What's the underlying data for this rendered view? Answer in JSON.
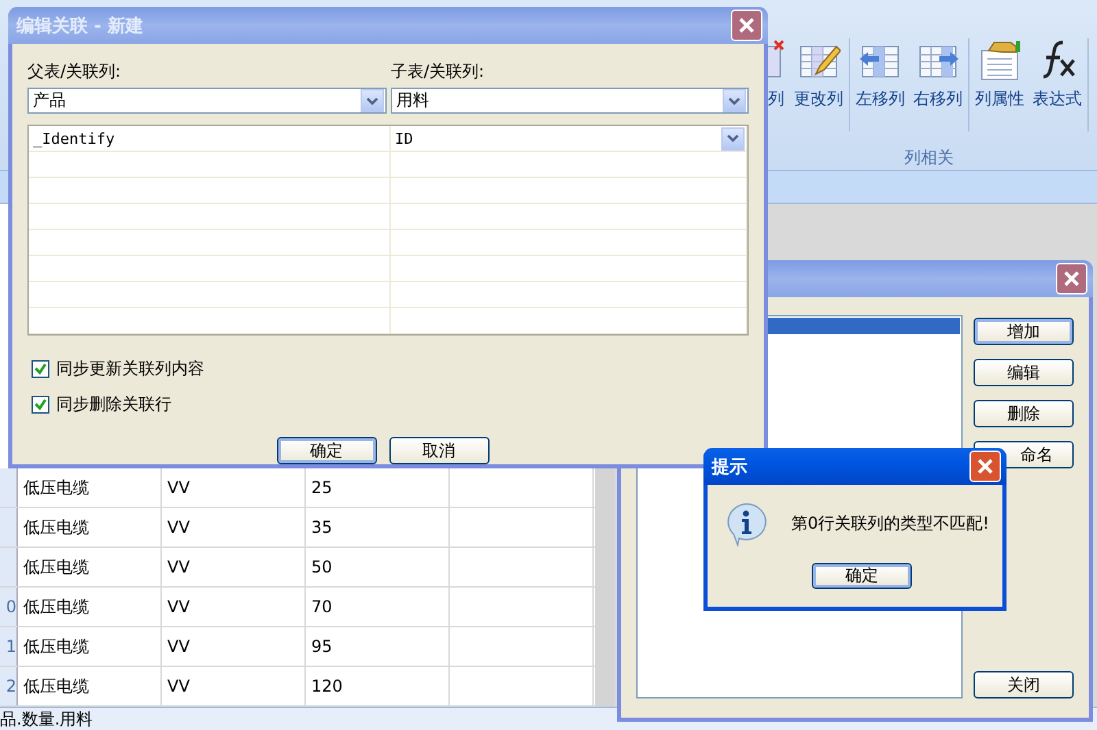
{
  "ribbon": {
    "button_groups": [
      [
        {
          "label": "列",
          "kind": "delete-column"
        },
        {
          "label": "更改列",
          "kind": "edit-column"
        }
      ],
      [
        {
          "label": "左移列",
          "kind": "move-left"
        },
        {
          "label": "右移列",
          "kind": "move-right"
        }
      ],
      [
        {
          "label": "列属性",
          "kind": "properties"
        },
        {
          "label": "表达式",
          "kind": "expression"
        }
      ]
    ],
    "group_label": "列相关"
  },
  "grid": {
    "rows": [
      {
        "cells": [
          "低压电缆",
          "VV",
          "25"
        ]
      },
      {
        "cells": [
          "低压电缆",
          "VV",
          "35"
        ]
      },
      {
        "cells": [
          "低压电缆",
          "VV",
          "50"
        ]
      },
      {
        "row_header": "0",
        "cells": [
          "低压电缆",
          "VV",
          "70"
        ]
      },
      {
        "row_header": "1",
        "cells": [
          "低压电缆",
          "VV",
          "95"
        ]
      },
      {
        "row_header": "2",
        "cells": [
          "低压电缆",
          "VV",
          "120"
        ]
      }
    ]
  },
  "status_bar": "品.数量.用料",
  "edit_dialog": {
    "title": "编辑关联 - 新建",
    "parent_label": "父表/关联列:",
    "parent_value": "产品",
    "child_label": "子表/关联列:",
    "child_value": "用料",
    "mappings": [
      {
        "parent": "_Identify",
        "child": "ID"
      }
    ],
    "checkboxes": [
      {
        "label": "同步更新关联列内容",
        "checked": true
      },
      {
        "label": "同步删除关联行",
        "checked": true
      }
    ],
    "buttons": [
      {
        "label": "确定",
        "default": true
      },
      {
        "label": "取消",
        "default": false
      }
    ]
  },
  "relation_dialog": {
    "list_items": [
      {
        "selected": true
      }
    ],
    "buttons": [
      "增加",
      "编辑",
      "删除",
      "命名"
    ],
    "close_button": "关闭"
  },
  "message_box": {
    "title": "提示",
    "message": "第0行关联列的类型不匹配!",
    "button": "确定"
  }
}
